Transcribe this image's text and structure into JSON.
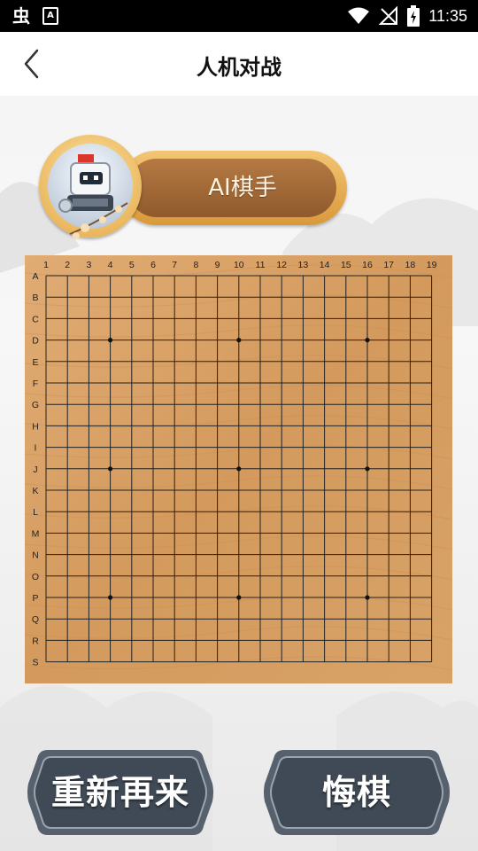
{
  "status_bar": {
    "time": "11:35",
    "icons": [
      "bug-app-icon",
      "accessibility-a-icon",
      "wifi-icon",
      "no-signal-icon",
      "battery-charging-icon"
    ]
  },
  "app_bar": {
    "title": "人机对战",
    "back_icon": "chevron-left-icon"
  },
  "player": {
    "label": "AI棋手",
    "avatar": "robot-avatar"
  },
  "board": {
    "size": 19,
    "col_labels": [
      "1",
      "2",
      "3",
      "4",
      "5",
      "6",
      "7",
      "8",
      "9",
      "10",
      "11",
      "12",
      "13",
      "14",
      "15",
      "16",
      "17",
      "18",
      "19"
    ],
    "row_labels": [
      "A",
      "B",
      "C",
      "D",
      "E",
      "F",
      "G",
      "H",
      "I",
      "J",
      "K",
      "L",
      "M",
      "N",
      "O",
      "P",
      "Q",
      "R",
      "S"
    ],
    "star_points": [
      [
        4,
        4
      ],
      [
        10,
        4
      ],
      [
        16,
        4
      ],
      [
        4,
        10
      ],
      [
        10,
        10
      ],
      [
        16,
        10
      ],
      [
        4,
        16
      ],
      [
        10,
        16
      ],
      [
        16,
        16
      ]
    ],
    "wood_color": "#d9a36a"
  },
  "actions": {
    "restart_label": "重新再来",
    "undo_label": "悔棋"
  }
}
